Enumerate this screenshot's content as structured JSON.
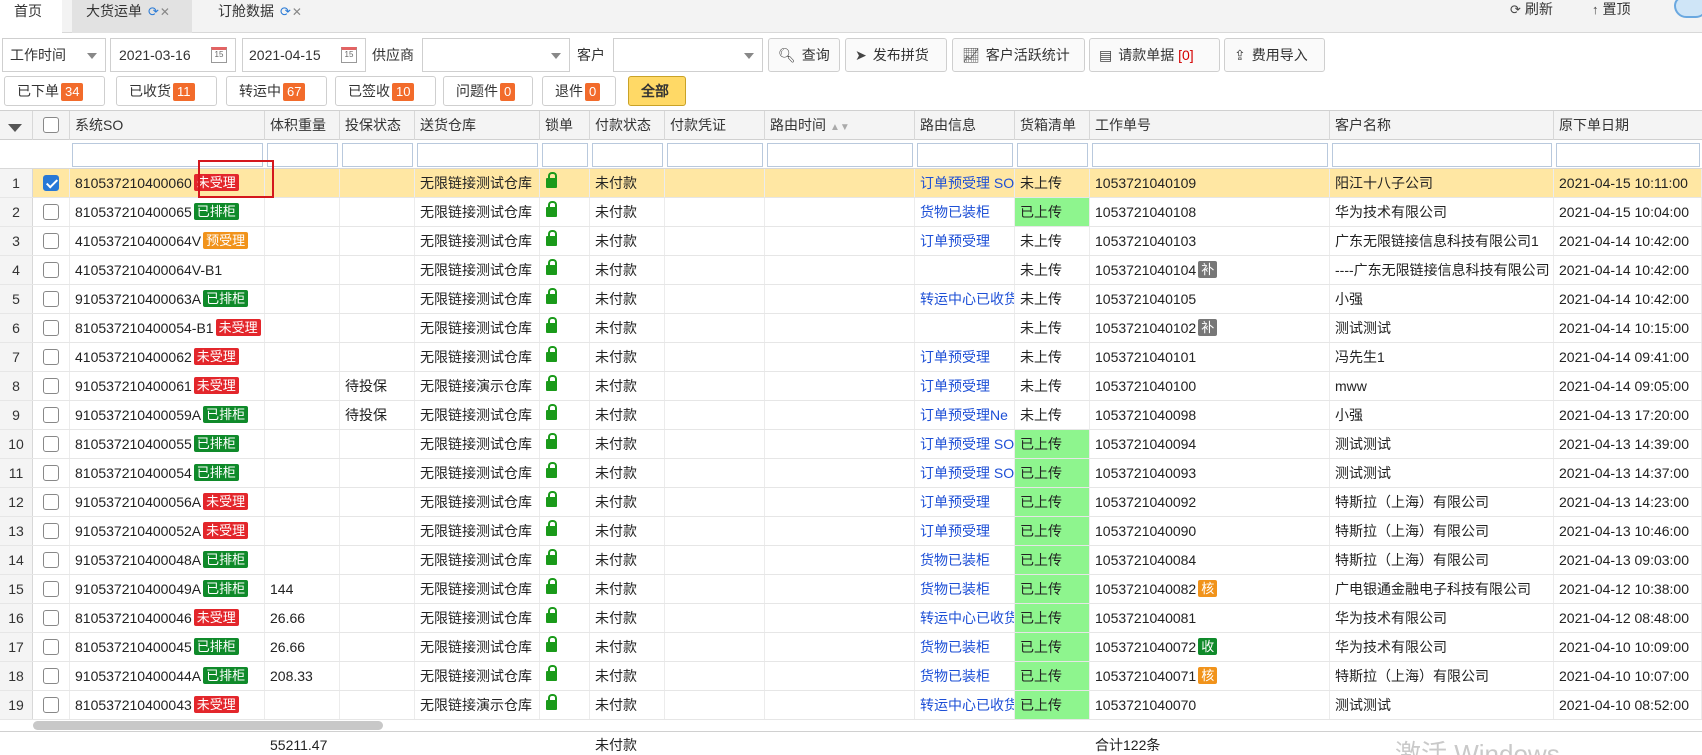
{
  "tabs": [
    {
      "label": "首页",
      "closable": false
    },
    {
      "label": "大货运单",
      "closable": true
    },
    {
      "label": "订舱数据",
      "closable": true
    }
  ],
  "top_actions": {
    "refresh": "刷新",
    "top": "置顶"
  },
  "filters": {
    "date_type": "工作时间",
    "date_from": "2021-03-16",
    "date_to": "2021-04-15",
    "supplier_label": "供应商",
    "supplier_value": "",
    "customer_label": "客户",
    "customer_value": ""
  },
  "toolbar": {
    "query": "查询",
    "publish": "发布拼货",
    "stats": "客户活跃统计",
    "invoice": "请款单据",
    "invoice_count": "[0]",
    "import": "费用导入"
  },
  "status_chips": [
    {
      "label": "已下单",
      "count": "34"
    },
    {
      "label": "已收货",
      "count": "11"
    },
    {
      "label": "转运中",
      "count": "67"
    },
    {
      "label": "已签收",
      "count": "10"
    },
    {
      "label": "问题件",
      "count": "0"
    },
    {
      "label": "退件",
      "count": "0"
    },
    {
      "label": "全部",
      "count": ""
    }
  ],
  "columns": [
    "系统SO",
    "体积重量",
    "投保状态",
    "送货仓库",
    "锁单",
    "付款状态",
    "付款凭证",
    "路由时间",
    "路由信息",
    "货箱清单",
    "工作单号",
    "客户名称",
    "原下单日期"
  ],
  "rows": [
    {
      "n": "1",
      "so": "810537210400060",
      "badge": "未受理",
      "badge_color": "red",
      "weight": "",
      "insure": "",
      "warehouse": "无限链接测试仓库",
      "pay": "未付款",
      "route": "订单预受理 SO",
      "box": "未上传",
      "box_green": false,
      "job": "1053721040109",
      "job_badge": "",
      "job_badge_color": "",
      "customer": "阳江十八子公司",
      "date": "2021-04-15 10:11:00",
      "selected": true
    },
    {
      "n": "2",
      "so": "810537210400065",
      "badge": "已排柜",
      "badge_color": "green",
      "weight": "",
      "insure": "",
      "warehouse": "无限链接测试仓库",
      "pay": "未付款",
      "route": "货物已装柜",
      "box": "已上传",
      "box_green": true,
      "job": "1053721040108",
      "job_badge": "",
      "job_badge_color": "",
      "customer": "华为技术有限公司",
      "date": "2021-04-15 10:04:00",
      "selected": false
    },
    {
      "n": "3",
      "so": "410537210400064V",
      "badge": "预受理",
      "badge_color": "orange",
      "weight": "",
      "insure": "",
      "warehouse": "无限链接测试仓库",
      "pay": "未付款",
      "route": "订单预受理",
      "box": "未上传",
      "box_green": false,
      "job": "1053721040103",
      "job_badge": "",
      "job_badge_color": "",
      "customer": "广东无限链接信息科技有限公司1",
      "date": "2021-04-14 10:42:00",
      "selected": false
    },
    {
      "n": "4",
      "so": "410537210400064V-B1",
      "badge": "",
      "badge_color": "",
      "weight": "",
      "insure": "",
      "warehouse": "无限链接测试仓库",
      "pay": "未付款",
      "route": "",
      "box": "未上传",
      "box_green": false,
      "job": "1053721040104",
      "job_badge": "补",
      "job_badge_color": "gray",
      "customer": "----广东无限链接信息科技有限公司",
      "date": "2021-04-14 10:42:00",
      "selected": false
    },
    {
      "n": "5",
      "so": "910537210400063A",
      "badge": "已排柜",
      "badge_color": "green",
      "weight": "",
      "insure": "",
      "warehouse": "无限链接测试仓库",
      "pay": "未付款",
      "route": "转运中心已收货",
      "box": "未上传",
      "box_green": false,
      "job": "1053721040105",
      "job_badge": "",
      "job_badge_color": "",
      "customer": "小强",
      "date": "2021-04-14 10:42:00",
      "selected": false
    },
    {
      "n": "6",
      "so": "810537210400054-B1",
      "badge": "未受理",
      "badge_color": "red",
      "weight": "",
      "insure": "",
      "warehouse": "无限链接测试仓库",
      "pay": "未付款",
      "route": "",
      "box": "未上传",
      "box_green": false,
      "job": "1053721040102",
      "job_badge": "补",
      "job_badge_color": "gray",
      "customer": "测试测试",
      "date": "2021-04-14 10:15:00",
      "selected": false
    },
    {
      "n": "7",
      "so": "410537210400062",
      "badge": "未受理",
      "badge_color": "red",
      "weight": "",
      "insure": "",
      "warehouse": "无限链接测试仓库",
      "pay": "未付款",
      "route": "订单预受理",
      "box": "未上传",
      "box_green": false,
      "job": "1053721040101",
      "job_badge": "",
      "job_badge_color": "",
      "customer": "冯先生1",
      "date": "2021-04-14 09:41:00",
      "selected": false
    },
    {
      "n": "8",
      "so": "910537210400061",
      "badge": "未受理",
      "badge_color": "red",
      "weight": "",
      "insure": "待投保",
      "warehouse": "无限链接演示仓库",
      "pay": "未付款",
      "route": "订单预受理",
      "box": "未上传",
      "box_green": false,
      "job": "1053721040100",
      "job_badge": "",
      "job_badge_color": "",
      "customer": "mww",
      "date": "2021-04-14 09:05:00",
      "selected": false
    },
    {
      "n": "9",
      "so": "910537210400059A",
      "badge": "已排柜",
      "badge_color": "green",
      "weight": "",
      "insure": "待投保",
      "warehouse": "无限链接测试仓库",
      "pay": "未付款",
      "route": "订单预受理Ne",
      "box": "未上传",
      "box_green": false,
      "job": "1053721040098",
      "job_badge": "",
      "job_badge_color": "",
      "customer": "小强",
      "date": "2021-04-13 17:20:00",
      "selected": false
    },
    {
      "n": "10",
      "so": "810537210400055",
      "badge": "已排柜",
      "badge_color": "green",
      "weight": "",
      "insure": "",
      "warehouse": "无限链接测试仓库",
      "pay": "未付款",
      "route": "订单预受理 SO",
      "box": "已上传",
      "box_green": true,
      "job": "1053721040094",
      "job_badge": "",
      "job_badge_color": "",
      "customer": "测试测试",
      "date": "2021-04-13 14:39:00",
      "selected": false
    },
    {
      "n": "11",
      "so": "810537210400054",
      "badge": "已排柜",
      "badge_color": "green",
      "weight": "",
      "insure": "",
      "warehouse": "无限链接测试仓库",
      "pay": "未付款",
      "route": "订单预受理 SO",
      "box": "已上传",
      "box_green": true,
      "job": "1053721040093",
      "job_badge": "",
      "job_badge_color": "",
      "customer": "测试测试",
      "date": "2021-04-13 14:37:00",
      "selected": false
    },
    {
      "n": "12",
      "so": "910537210400056A",
      "badge": "未受理",
      "badge_color": "red",
      "weight": "",
      "insure": "",
      "warehouse": "无限链接测试仓库",
      "pay": "未付款",
      "route": "订单预受理",
      "box": "已上传",
      "box_green": true,
      "job": "1053721040092",
      "job_badge": "",
      "job_badge_color": "",
      "customer": "特斯拉（上海）有限公司",
      "date": "2021-04-13 14:23:00",
      "selected": false
    },
    {
      "n": "13",
      "so": "910537210400052A",
      "badge": "未受理",
      "badge_color": "red",
      "weight": "",
      "insure": "",
      "warehouse": "无限链接测试仓库",
      "pay": "未付款",
      "route": "订单预受理",
      "box": "已上传",
      "box_green": true,
      "job": "1053721040090",
      "job_badge": "",
      "job_badge_color": "",
      "customer": "特斯拉（上海）有限公司",
      "date": "2021-04-13 10:46:00",
      "selected": false
    },
    {
      "n": "14",
      "so": "910537210400048A",
      "badge": "已排柜",
      "badge_color": "green",
      "weight": "",
      "insure": "",
      "warehouse": "无限链接测试仓库",
      "pay": "未付款",
      "route": "货物已装柜",
      "box": "已上传",
      "box_green": true,
      "job": "1053721040084",
      "job_badge": "",
      "job_badge_color": "",
      "customer": "特斯拉（上海）有限公司",
      "date": "2021-04-13 09:03:00",
      "selected": false
    },
    {
      "n": "15",
      "so": "910537210400049A",
      "badge": "已排柜",
      "badge_color": "green",
      "weight": "144",
      "insure": "",
      "warehouse": "无限链接测试仓库",
      "pay": "未付款",
      "route": "货物已装柜",
      "box": "已上传",
      "box_green": true,
      "job": "1053721040082",
      "job_badge": "核",
      "job_badge_color": "orange",
      "customer": "广电银通金融电子科技有限公司",
      "date": "2021-04-12 10:38:00",
      "selected": false
    },
    {
      "n": "16",
      "so": "810537210400046",
      "badge": "未受理",
      "badge_color": "red",
      "weight": "26.66",
      "insure": "",
      "warehouse": "无限链接测试仓库",
      "pay": "未付款",
      "route": "转运中心已收货",
      "box": "已上传",
      "box_green": true,
      "job": "1053721040081",
      "job_badge": "",
      "job_badge_color": "",
      "customer": "华为技术有限公司",
      "date": "2021-04-12 08:48:00",
      "selected": false
    },
    {
      "n": "17",
      "so": "810537210400045",
      "badge": "已排柜",
      "badge_color": "green",
      "weight": "26.66",
      "insure": "",
      "warehouse": "无限链接测试仓库",
      "pay": "未付款",
      "route": "货物已装柜",
      "box": "已上传",
      "box_green": true,
      "job": "1053721040072",
      "job_badge": "收",
      "job_badge_color": "green",
      "customer": "华为技术有限公司",
      "date": "2021-04-10 10:09:00",
      "selected": false
    },
    {
      "n": "18",
      "so": "910537210400044A",
      "badge": "已排柜",
      "badge_color": "green",
      "weight": "208.33",
      "insure": "",
      "warehouse": "无限链接测试仓库",
      "pay": "未付款",
      "route": "货物已装柜",
      "box": "已上传",
      "box_green": true,
      "job": "1053721040071",
      "job_badge": "核",
      "job_badge_color": "orange",
      "customer": "特斯拉（上海）有限公司",
      "date": "2021-04-10 10:07:00",
      "selected": false
    },
    {
      "n": "19",
      "so": "810537210400043",
      "badge": "未受理",
      "badge_color": "red",
      "weight": "",
      "insure": "",
      "warehouse": "无限链接演示仓库",
      "pay": "未付款",
      "route": "转运中心已收货",
      "box": "已上传",
      "box_green": true,
      "job": "1053721040070",
      "job_badge": "",
      "job_badge_color": "",
      "customer": "测试测试",
      "date": "2021-04-10 08:52:00",
      "selected": false
    }
  ],
  "footer": {
    "weight_total": "55211.47",
    "pay_status": "未付款",
    "total_count": "合计122条"
  },
  "watermark": "激活 Windows",
  "colors": {
    "badge_red": "#e3262b",
    "badge_green": "#0f8a2a",
    "badge_orange": "#f1931b",
    "selected_row": "#ffe7a3",
    "uploaded_green": "#8ef58e",
    "link_blue": "#1d4fd6"
  }
}
